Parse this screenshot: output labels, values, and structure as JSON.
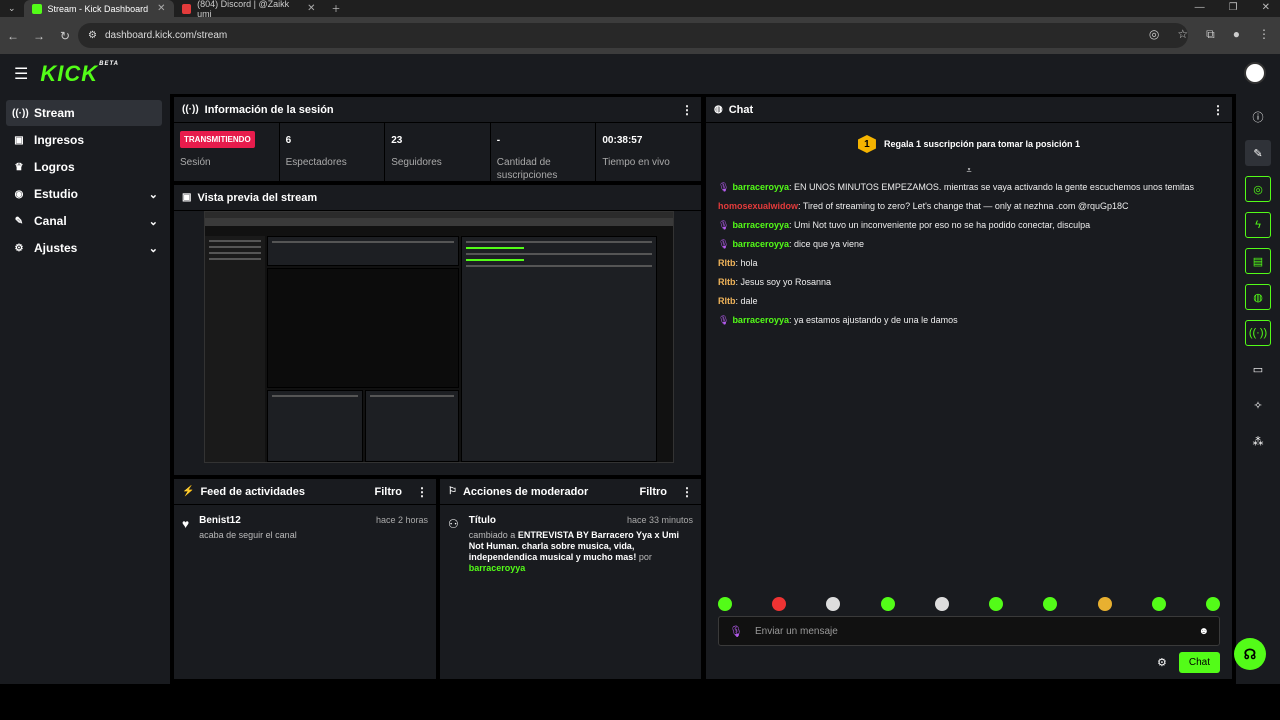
{
  "browser": {
    "tabs": [
      {
        "title": "Stream - Kick Dashboard",
        "active": true
      },
      {
        "title": "(804) Discord | @Zaikk umi",
        "active": false
      }
    ],
    "url": "dashboard.kick.com/stream"
  },
  "brand": {
    "logo": "KICK",
    "beta": "BETA",
    "accent": "#53fc18"
  },
  "sidebar": {
    "items": [
      {
        "label": "Stream",
        "icon": "broadcast-icon",
        "active": true
      },
      {
        "label": "Ingresos",
        "icon": "money-icon"
      },
      {
        "label": "Logros",
        "icon": "trophy-icon"
      },
      {
        "label": "Estudio",
        "icon": "studio-icon",
        "expandable": true
      },
      {
        "label": "Canal",
        "icon": "channel-icon",
        "expandable": true
      },
      {
        "label": "Ajustes",
        "icon": "gear-icon",
        "expandable": true
      }
    ]
  },
  "session": {
    "title": "Información de la sesión",
    "status_badge": "TRANSMITIENDO",
    "status_label": "Sesión",
    "stats": [
      {
        "value": "6",
        "label": "Espectadores"
      },
      {
        "value": "23",
        "label": "Seguidores"
      },
      {
        "value": "-",
        "label": "Cantidad de suscripciones"
      },
      {
        "value": "00:38:57",
        "label": "Tiempo en vivo"
      }
    ]
  },
  "preview": {
    "title": "Vista previa del stream"
  },
  "activity": {
    "title": "Feed de actividades",
    "filter": "Filtro",
    "items": [
      {
        "user": "Benist12",
        "text": "acaba de seguir el canal",
        "time": "hace 2 horas"
      }
    ]
  },
  "moderator": {
    "title": "Acciones de moderador",
    "filter": "Filtro",
    "items": [
      {
        "title": "Título",
        "time": "hace 33 minutos",
        "prefix": "cambiado a",
        "new_title": "ENTREVISTA BY Barracero Yya x Umi Not Human. charla sobre musica, vida, independendica musical y mucho mas!",
        "by": "por",
        "mod": "barraceroyya"
      }
    ]
  },
  "chat": {
    "title": "Chat",
    "banner": "Regala 1 suscripción para tomar la posición 1",
    "banner_rank": "1",
    "messages": [
      {
        "user": "barraceroyya",
        "color": "#53fc18",
        "mic": true,
        "text": "EN UNOS MINUTOS EMPEZAMOS. mientras se vaya activando la gente escuchemos unos temitas"
      },
      {
        "user": "homosexualwidow",
        "color": "#e33b3b",
        "mic": false,
        "text": "Tired of streaming to zero? Let's change that — only at nezhna .com @rquGp18C"
      },
      {
        "user": "barraceroyya",
        "color": "#53fc18",
        "mic": true,
        "text": "Umi Not tuvo un inconveniente por eso no se ha podido conectar, disculpa"
      },
      {
        "user": "barraceroyya",
        "color": "#53fc18",
        "mic": true,
        "text": "dice que ya viene"
      },
      {
        "user": "Rltb",
        "color": "#f0b45a",
        "mic": false,
        "text": "hola"
      },
      {
        "user": "Rltb",
        "color": "#f0b45a",
        "mic": false,
        "text": "Jesus soy yo Rosanna"
      },
      {
        "user": "Rltb",
        "color": "#f0b45a",
        "mic": false,
        "text": "dale"
      },
      {
        "user": "barraceroyya",
        "color": "#53fc18",
        "mic": true,
        "text": "ya estamos ajustando y de una le damos"
      }
    ],
    "input_placeholder": "Enviar un mensaje",
    "send_label": "Chat"
  }
}
